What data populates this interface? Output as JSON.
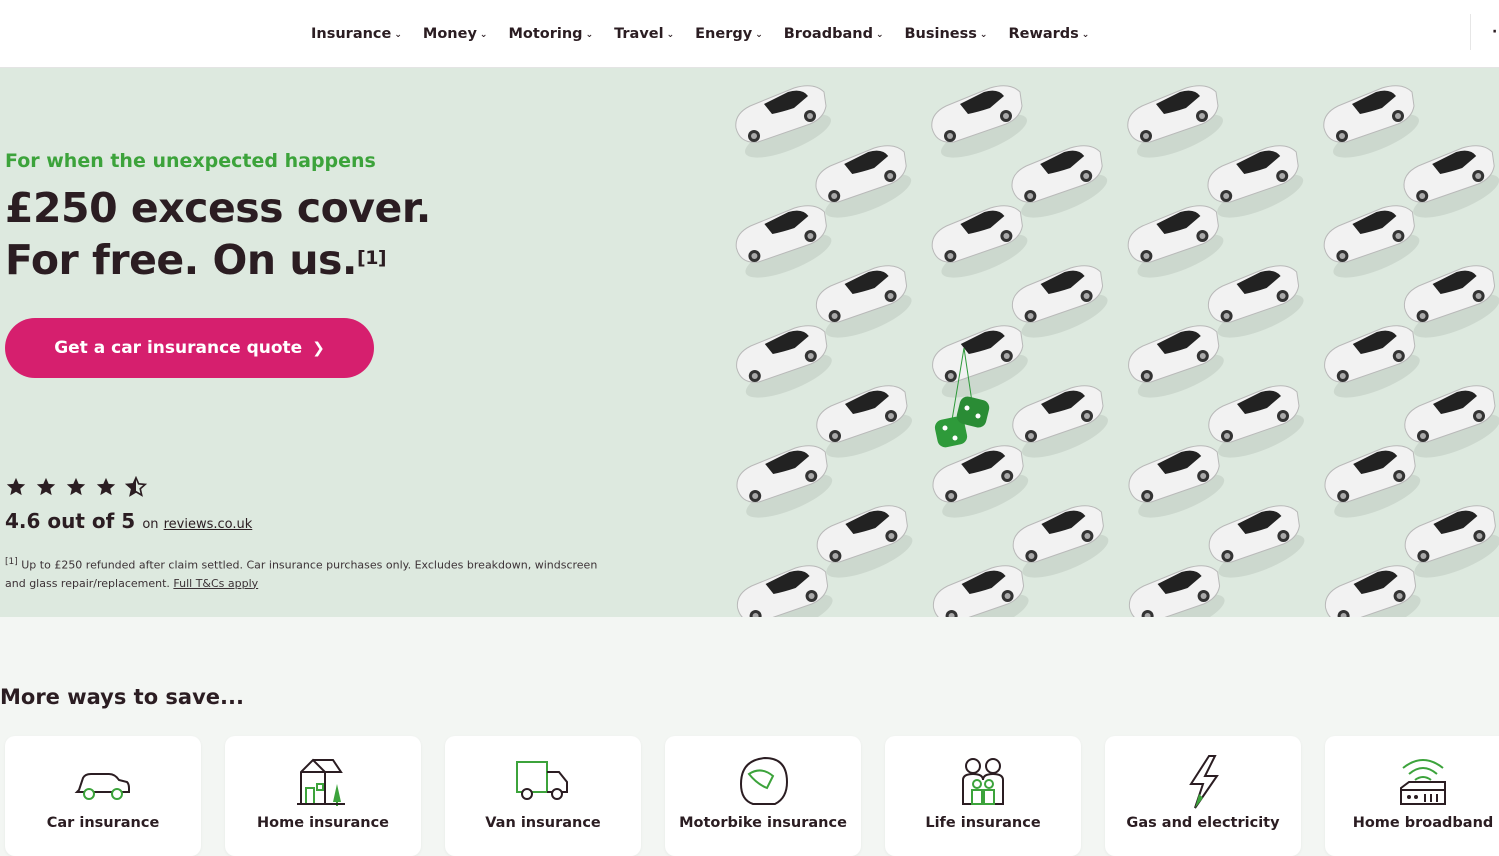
{
  "nav": {
    "items": [
      {
        "label": "Insurance"
      },
      {
        "label": "Money"
      },
      {
        "label": "Motoring"
      },
      {
        "label": "Travel"
      },
      {
        "label": "Energy"
      },
      {
        "label": "Broadband"
      },
      {
        "label": "Business"
      },
      {
        "label": "Rewards"
      }
    ]
  },
  "hero": {
    "eyebrow": "For when the unexpected happens",
    "headline_line1": "£250 excess cover.",
    "headline_line2": "For free. On us.",
    "footnote_marker": "[1]",
    "cta_label": "Get a car insurance quote",
    "rating": {
      "stars": 4.6,
      "score": "4.6 out of 5",
      "on": "on",
      "source": "reviews.co.uk"
    },
    "disclaimer": {
      "marker": "[1]",
      "text": " Up to £250 refunded after claim settled. Car insurance purchases only. Excludes breakdown, windscreen and glass repair/replacement. ",
      "link": "Full T&Cs apply"
    }
  },
  "more_ways": {
    "title": "More ways to save...",
    "cards": [
      {
        "label": "Car insurance",
        "icon": "car-icon"
      },
      {
        "label": "Home insurance",
        "icon": "house-icon"
      },
      {
        "label": "Van insurance",
        "icon": "van-icon"
      },
      {
        "label": "Motorbike insurance",
        "icon": "helmet-icon"
      },
      {
        "label": "Life insurance",
        "icon": "family-icon"
      },
      {
        "label": "Gas and electricity",
        "icon": "lightning-icon"
      },
      {
        "label": "Home broadband",
        "icon": "router-icon"
      }
    ]
  },
  "colors": {
    "brand_pink": "#d61f6e",
    "brand_green": "#3ca33b",
    "hero_bg": "#dde9df",
    "text_dark": "#2b1d22"
  }
}
